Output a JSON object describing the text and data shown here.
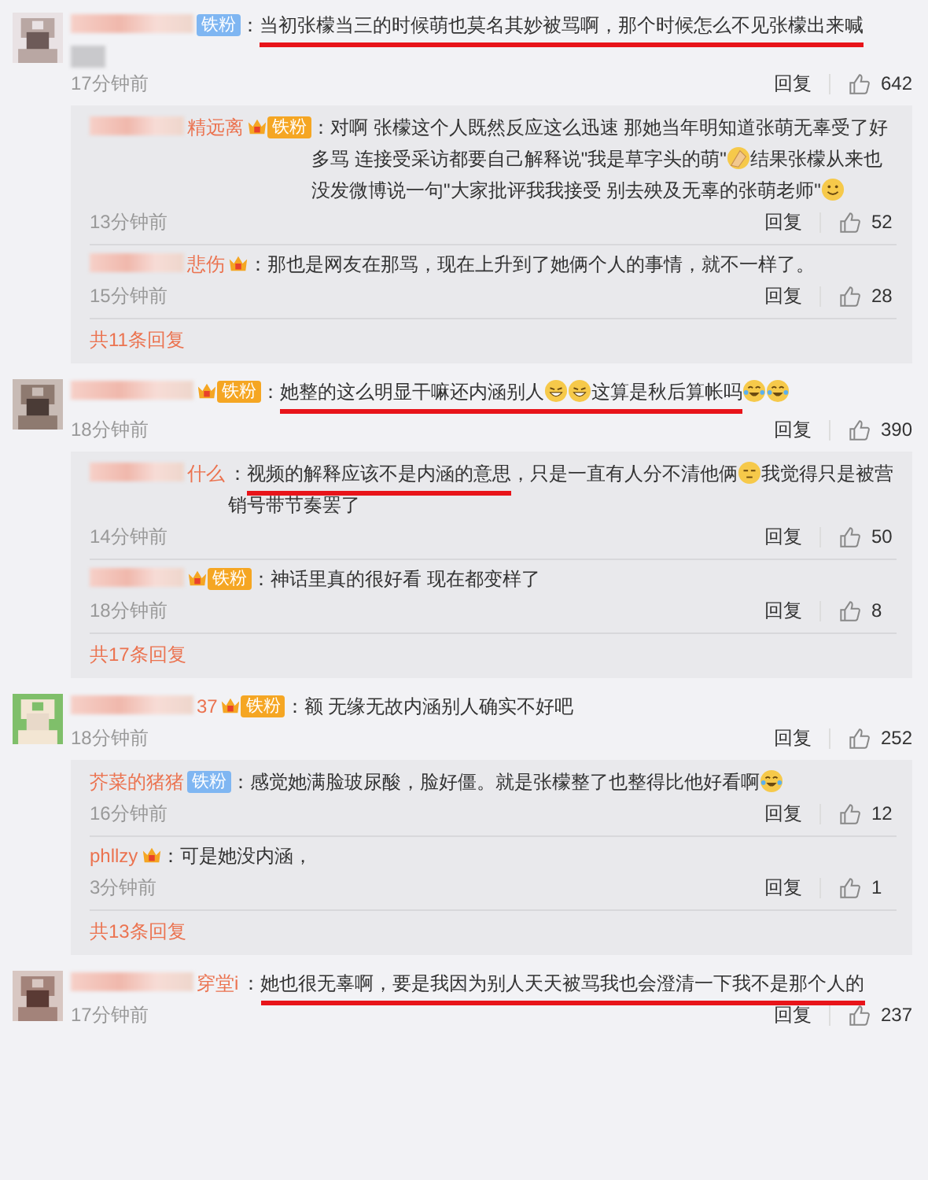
{
  "comments": [
    {
      "avatar": {
        "kind": "picture"
      },
      "name_blurred": true,
      "name_overflow": true,
      "badge": {
        "kind": "blue",
        "text": "铁粉"
      },
      "content": [
        {
          "kind": "text",
          "text": "："
        },
        {
          "kind": "text",
          "text": "当初张檬当三的时候萌也莫名其妙被骂啊，那个时候怎么不见张檬出来喊",
          "underlined": true
        }
      ],
      "time": "17分钟前",
      "reply_label": "回复",
      "likes": "642",
      "replies": [
        {
          "name_blurred": true,
          "name_tail": "精远离",
          "badge": {
            "kind": "orange",
            "text": "铁粉"
          },
          "content": [
            {
              "kind": "text",
              "text": "："
            },
            {
              "kind": "text",
              "text": "对啊 张檬这个人既然反应这么迅速 那她当年明知道张萌无辜受了好多骂 连接受采访都要自己解释说\"我是草字头的萌\""
            },
            {
              "kind": "hands"
            },
            {
              "kind": "text",
              "text": "结果张檬从来也没发微博说一句\"大家批评我我接受 别去殃及无辜的张萌老师\""
            },
            {
              "kind": "smile"
            }
          ],
          "time": "13分钟前",
          "reply_label": "回复",
          "likes": "52"
        },
        {
          "name_blurred": true,
          "name_tail": "悲伤",
          "badge": {
            "kind": "crown"
          },
          "content": [
            {
              "kind": "text",
              "text": "："
            },
            {
              "kind": "text",
              "text": "那也是网友在那骂，现在上升到了她俩个人的事情，就不一样了。"
            }
          ],
          "time": "15分钟前",
          "reply_label": "回复",
          "likes": "28"
        }
      ],
      "more_replies": "共11条回复"
    },
    {
      "avatar": {
        "kind": "picture"
      },
      "name_blurred": true,
      "badge": {
        "kind": "orange",
        "text": "铁粉"
      },
      "content": [
        {
          "kind": "text",
          "text": "："
        },
        {
          "kind": "text",
          "text": "她整的这么明显干嘛还内涵别人",
          "underlined": true
        },
        {
          "kind": "grin",
          "underlined": true
        },
        {
          "kind": "grin",
          "underlined": true
        },
        {
          "kind": "text",
          "text": "这算是秋后算帐吗",
          "underlined": true
        },
        {
          "kind": "laughcry"
        },
        {
          "kind": "laughcry"
        }
      ],
      "time": "18分钟前",
      "reply_label": "回复",
      "likes": "390",
      "replies": [
        {
          "name_blurred": true,
          "name_tail": "什么",
          "content": [
            {
              "kind": "text",
              "text": "："
            },
            {
              "kind": "text",
              "text": "视频的解释应该不是内涵的意思",
              "underlined": true
            },
            {
              "kind": "text",
              "text": "，只是一直有人分不清他俩"
            },
            {
              "kind": "sleepy"
            },
            {
              "kind": "text",
              "text": "我觉得只是被营销号带节奏罢了"
            }
          ],
          "time": "14分钟前",
          "reply_label": "回复",
          "likes": "50"
        },
        {
          "name_blurred": true,
          "badge": {
            "kind": "orange",
            "text": "铁粉"
          },
          "content": [
            {
              "kind": "text",
              "text": "："
            },
            {
              "kind": "text",
              "text": "神话里真的很好看 现在都变样了"
            }
          ],
          "time": "18分钟前",
          "reply_label": "回复",
          "likes": "8"
        }
      ],
      "more_replies": "共17条回复"
    },
    {
      "avatar": {
        "kind": "picture"
      },
      "name_blurred": true,
      "name_tail": "37",
      "badge": {
        "kind": "orange",
        "text": "铁粉"
      },
      "content": [
        {
          "kind": "text",
          "text": "："
        },
        {
          "kind": "text",
          "text": "额 无缘无故内涵别人确实不好吧"
        }
      ],
      "time": "18分钟前",
      "reply_label": "回复",
      "likes": "252",
      "replies": [
        {
          "name_tail": "芥菜的猪猪",
          "badge": {
            "kind": "blue",
            "text": "铁粉"
          },
          "content": [
            {
              "kind": "text",
              "text": "："
            },
            {
              "kind": "text",
              "text": "感觉她满脸玻尿酸，脸好僵。就是张檬整了也整得比他好看啊"
            },
            {
              "kind": "laughcry"
            }
          ],
          "time": "16分钟前",
          "reply_label": "回复",
          "likes": "12"
        },
        {
          "name_tail": "phllzy",
          "badge": {
            "kind": "crown"
          },
          "content": [
            {
              "kind": "text",
              "text": "："
            },
            {
              "kind": "text",
              "text": "可是她没内涵，"
            }
          ],
          "time": "3分钟前",
          "reply_label": "回复",
          "likes": "1"
        }
      ],
      "more_replies": "共13条回复"
    },
    {
      "avatar": {
        "kind": "picture"
      },
      "name_blurred": true,
      "name_tail": "穿堂i",
      "content": [
        {
          "kind": "text",
          "text": "："
        },
        {
          "kind": "text",
          "text": "她也很无辜啊，要是我因为别人天天被骂我也会澄清一下我不是那个人的",
          "underlined": true
        }
      ],
      "time": "17分钟前",
      "reply_label": "回复",
      "likes": "237"
    }
  ]
}
